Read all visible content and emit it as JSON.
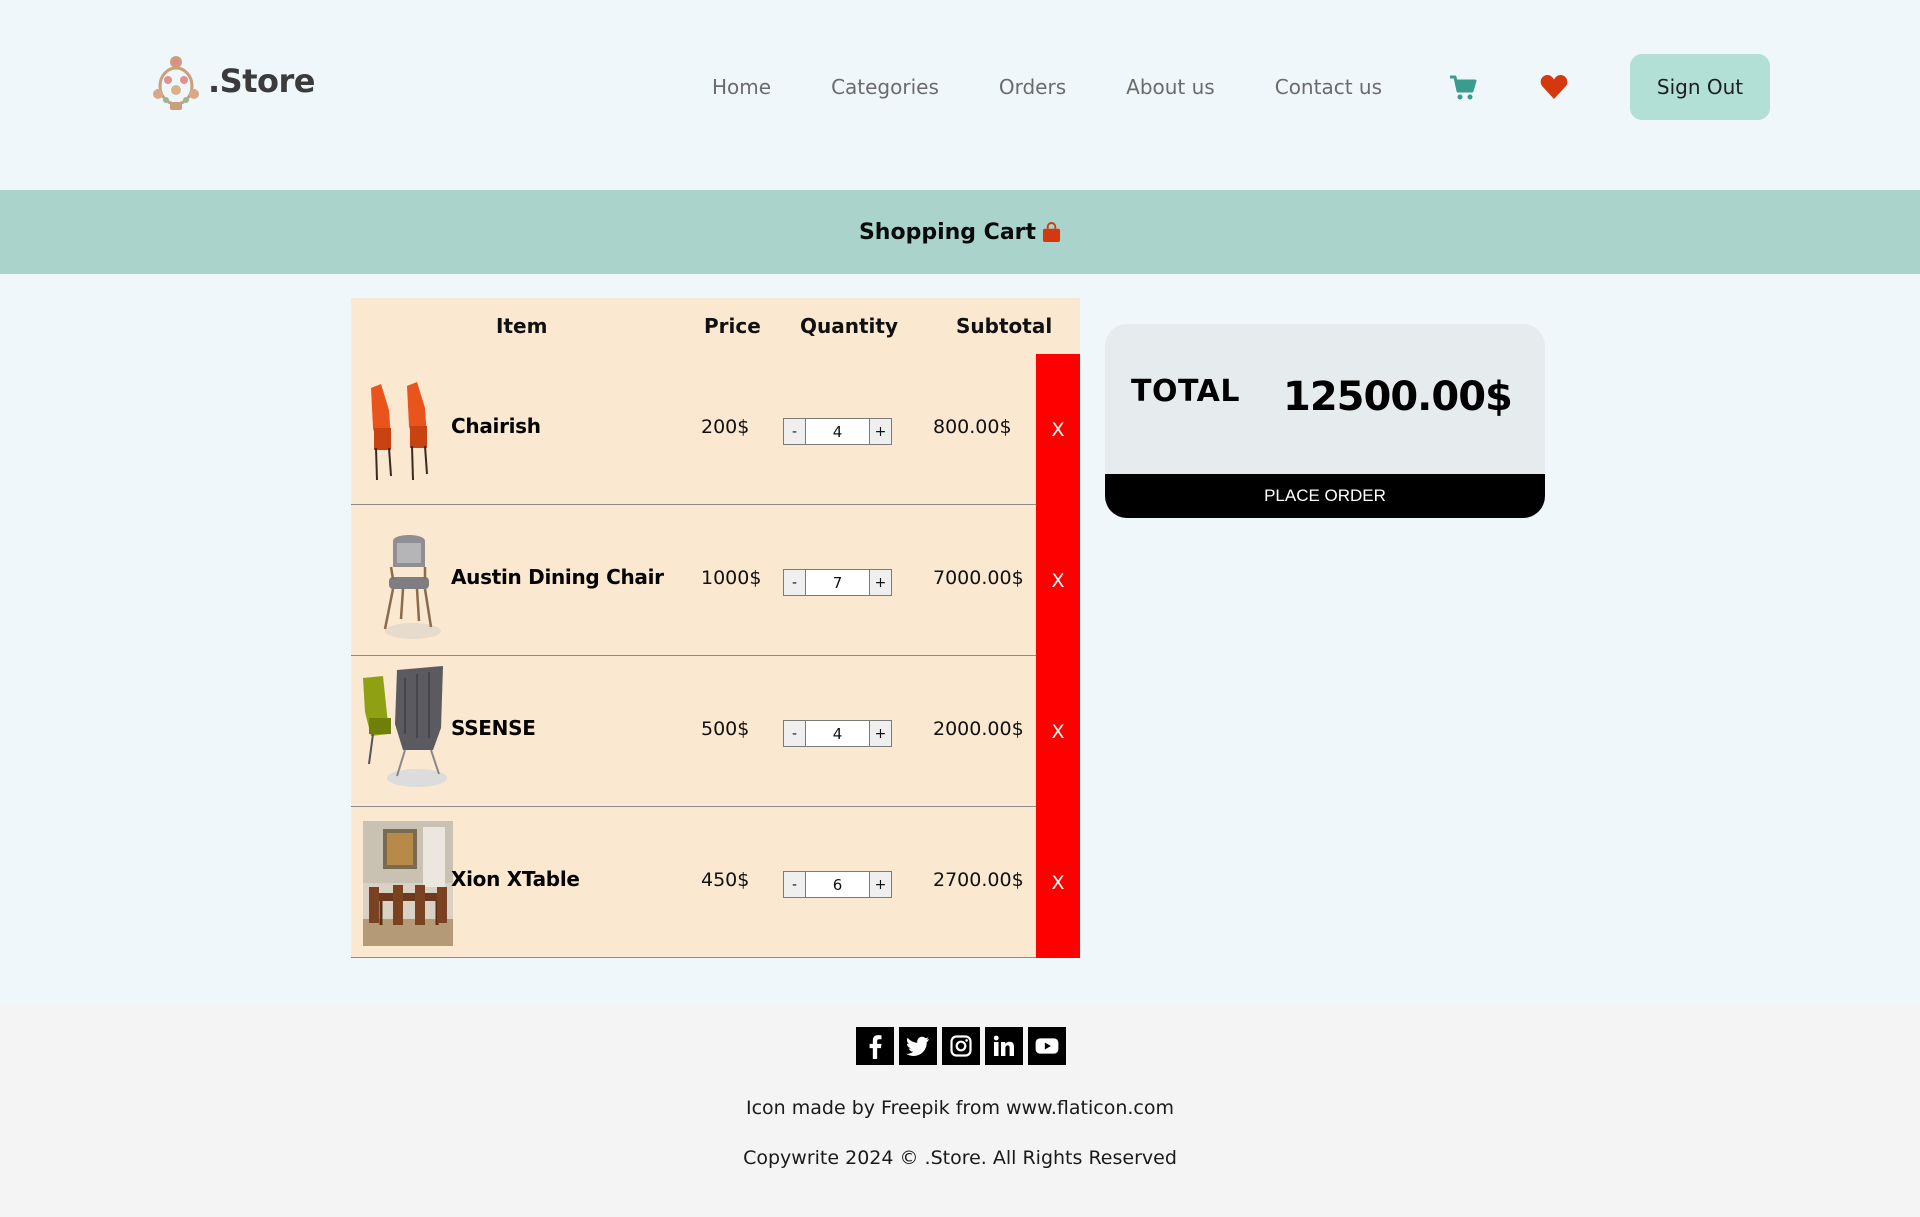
{
  "brand": {
    "name": ".Store"
  },
  "nav": {
    "links": [
      "Home",
      "Categories",
      "Orders",
      "About us",
      "Contact us"
    ],
    "icons": [
      "cart-icon",
      "heart-icon"
    ],
    "signout_label": "Sign Out"
  },
  "banner": {
    "title": "Shopping Cart",
    "icon": "shopping-bag-icon"
  },
  "cart": {
    "headers": {
      "item": "Item",
      "price": "Price",
      "quantity": "Quantity",
      "subtotal": "Subtotal"
    },
    "remove_label": "X",
    "minus_label": "-",
    "plus_label": "+",
    "rows": [
      {
        "name": "Chairish",
        "price": "200$",
        "quantity": "4",
        "subtotal": "800.00$"
      },
      {
        "name": "Austin Dining Chair",
        "price": "1000$",
        "quantity": "7",
        "subtotal": "7000.00$"
      },
      {
        "name": "SSENSE",
        "price": "500$",
        "quantity": "4",
        "subtotal": "2000.00$"
      },
      {
        "name": "Xion XTable",
        "price": "450$",
        "quantity": "6",
        "subtotal": "2700.00$"
      }
    ]
  },
  "summary": {
    "total_label": "TOTAL",
    "total_value": "12500.00$",
    "place_order_label": "PLACE ORDER"
  },
  "footer": {
    "socials": [
      "facebook-icon",
      "twitter-icon",
      "instagram-icon",
      "linkedin-icon",
      "youtube-icon"
    ],
    "credit": "Icon made by Freepik from www.flaticon.com",
    "copyright": "Copywrite 2024 © .Store. All Rights Reserved"
  },
  "colors": {
    "page_bg": "#f0f7fa",
    "banner_bg": "#aad4cb",
    "signout_bg": "#b3e0d6",
    "cart_bg": "#fae8d1",
    "remove_bg": "#ff0000",
    "accent_teal": "#3a9c8c",
    "accent_red": "#d4380f"
  }
}
